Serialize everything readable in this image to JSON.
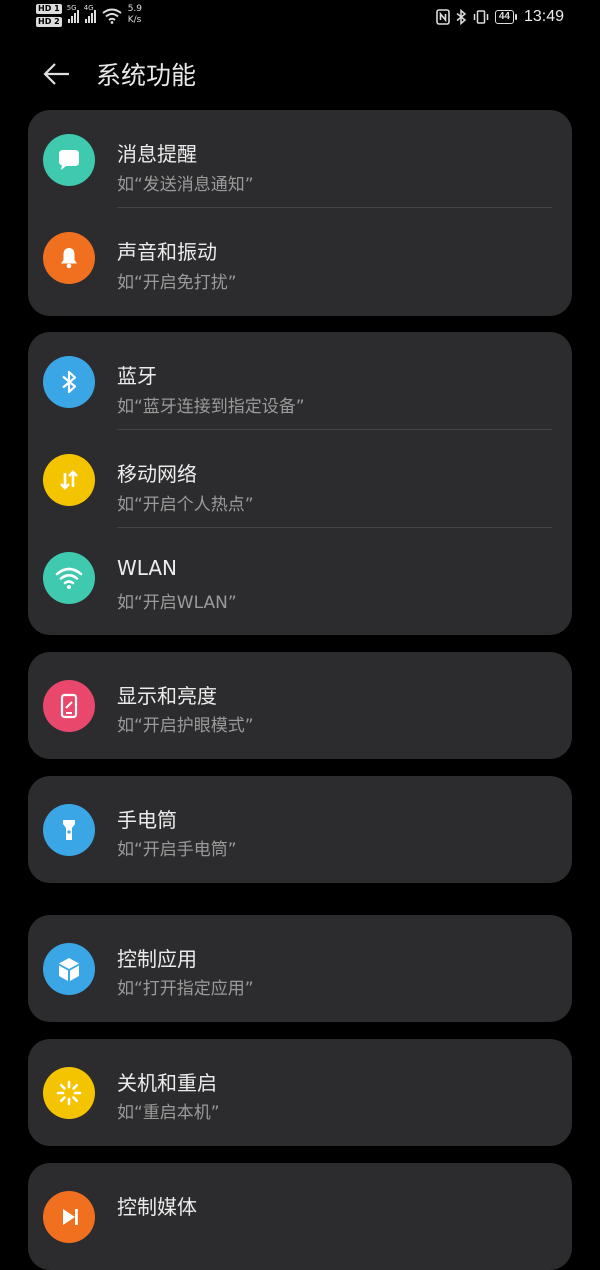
{
  "status_bar": {
    "hd1": "HD 1",
    "hd2": "HD 2",
    "net1": "5G",
    "net2": "4G",
    "speed_value": "5.9",
    "speed_unit": "K/s",
    "battery": "44",
    "time": "13:49",
    "icons": [
      "nfc-icon",
      "bluetooth-icon",
      "vibrate-icon",
      "battery-icon",
      "wifi-icon",
      "signal-icon"
    ]
  },
  "header": {
    "title": "系统功能",
    "back_icon": "arrow-left-icon"
  },
  "colors": {
    "teal": "#3fc9ae",
    "orange": "#f0701f",
    "blue": "#3aa6e6",
    "yellow": "#f5c400",
    "green": "#3fc9ae",
    "pink": "#e9476b",
    "card_bg": "#2c2c2e"
  },
  "groups": [
    {
      "items": [
        {
          "title": "消息提醒",
          "subtitle": "如“发送消息通知”",
          "icon": "message-bubble-icon"
        },
        {
          "title": "声音和振动",
          "subtitle": "如“开启免打扰”",
          "icon": "bell-icon"
        }
      ]
    },
    {
      "items": [
        {
          "title": "蓝牙",
          "subtitle": "如“蓝牙连接到指定设备”",
          "icon": "bluetooth-icon"
        },
        {
          "title": "移动网络",
          "subtitle": "如“开启个人热点”",
          "icon": "mobile-data-icon"
        },
        {
          "title": "WLAN",
          "subtitle": "如“开启WLAN”",
          "icon": "wifi-icon"
        }
      ]
    },
    {
      "items": [
        {
          "title": "显示和亮度",
          "subtitle": "如“开启护眼模式”",
          "icon": "display-icon"
        }
      ]
    },
    {
      "items": [
        {
          "title": "手电筒",
          "subtitle": "如“开启手电筒”",
          "icon": "flashlight-icon"
        }
      ]
    },
    {
      "items": [
        {
          "title": "控制应用",
          "subtitle": "如“打开指定应用”",
          "icon": "cube-icon"
        }
      ]
    },
    {
      "items": [
        {
          "title": "关机和重启",
          "subtitle": "如“重启本机”",
          "icon": "power-sun-icon"
        }
      ]
    },
    {
      "items": [
        {
          "title": "控制媒体",
          "subtitle": "",
          "icon": "media-play-icon"
        }
      ]
    }
  ]
}
